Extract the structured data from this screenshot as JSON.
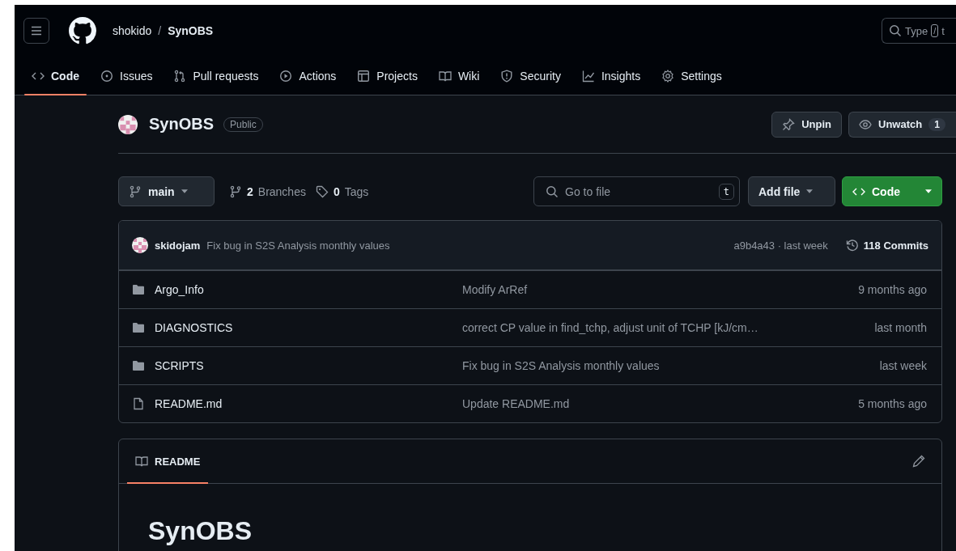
{
  "header": {
    "breadcrumb": {
      "owner": "shokido",
      "separator": "/",
      "repo": "SynOBS"
    },
    "search": {
      "placeholder": "Type",
      "shortcut": "/",
      "trailing": "t"
    }
  },
  "nav_tabs": [
    {
      "label": "Code",
      "selected": true
    },
    {
      "label": "Issues",
      "selected": false
    },
    {
      "label": "Pull requests",
      "selected": false
    },
    {
      "label": "Actions",
      "selected": false
    },
    {
      "label": "Projects",
      "selected": false
    },
    {
      "label": "Wiki",
      "selected": false
    },
    {
      "label": "Security",
      "selected": false
    },
    {
      "label": "Insights",
      "selected": false
    },
    {
      "label": "Settings",
      "selected": false
    }
  ],
  "repo": {
    "name": "SynOBS",
    "visibility": "Public",
    "buttons": [
      {
        "label": "Unpin"
      },
      {
        "label": "Unwatch",
        "count": "1"
      }
    ]
  },
  "branch_bar": {
    "branch": "main",
    "branches": {
      "count": "2",
      "label": "Branches"
    },
    "tags": {
      "count": "0",
      "label": "Tags"
    },
    "file_search": {
      "placeholder": "Go to file",
      "shortcut": "t"
    },
    "add_file": "Add file",
    "code_button": "Code"
  },
  "latest_commit": {
    "author": "skidojam",
    "message": "Fix bug in S2S Analysis monthly values",
    "hash_time": "a9b4a43 · last week",
    "commits": "118 Commits"
  },
  "files": [
    {
      "kind": "folder",
      "name": "Argo_Info",
      "message": "Modify ArRef",
      "time": "9 months ago"
    },
    {
      "kind": "folder",
      "name": "DIAGNOSTICS",
      "message": "correct CP value in find_tchp, adjust unit of TCHP [kJ/cm…",
      "time": "last month"
    },
    {
      "kind": "folder",
      "name": "SCRIPTS",
      "message": "Fix bug in S2S Analysis monthly values",
      "time": "last week"
    },
    {
      "kind": "file",
      "name": "README.md",
      "message": "Update README.md",
      "time": "5 months ago"
    }
  ],
  "readme": {
    "tab": "README",
    "heading": "SynOBS"
  }
}
